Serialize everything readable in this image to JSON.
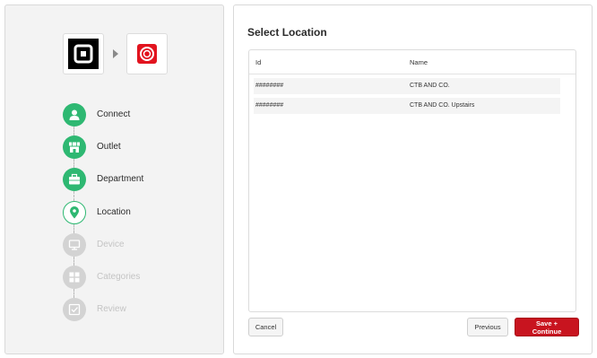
{
  "wizard": {
    "source_logo": "square-logo-icon",
    "target_logo": "target-logo-icon",
    "steps": [
      {
        "label": "Connect",
        "icon": "person-icon",
        "state": "done"
      },
      {
        "label": "Outlet",
        "icon": "store-icon",
        "state": "done"
      },
      {
        "label": "Department",
        "icon": "briefcase-icon",
        "state": "done"
      },
      {
        "label": "Location",
        "icon": "location-pin-icon",
        "state": "current"
      },
      {
        "label": "Device",
        "icon": "monitor-icon",
        "state": "todo"
      },
      {
        "label": "Categories",
        "icon": "grid-icon",
        "state": "todo"
      },
      {
        "label": "Review",
        "icon": "checkbox-icon",
        "state": "todo"
      }
    ]
  },
  "main": {
    "title": "Select Location",
    "table": {
      "columns": [
        "Id",
        "Name"
      ],
      "rows": [
        {
          "id": "########",
          "name": "CTB AND CO."
        },
        {
          "id": "########",
          "name": "CTB AND CO. Upstairs"
        }
      ]
    },
    "buttons": {
      "cancel": "Cancel",
      "previous": "Previous",
      "save": "Save + Continue"
    }
  },
  "colors": {
    "accent_green": "#2eb872",
    "primary_red": "#c8141f",
    "inactive_gray": "#d3d3d3"
  }
}
